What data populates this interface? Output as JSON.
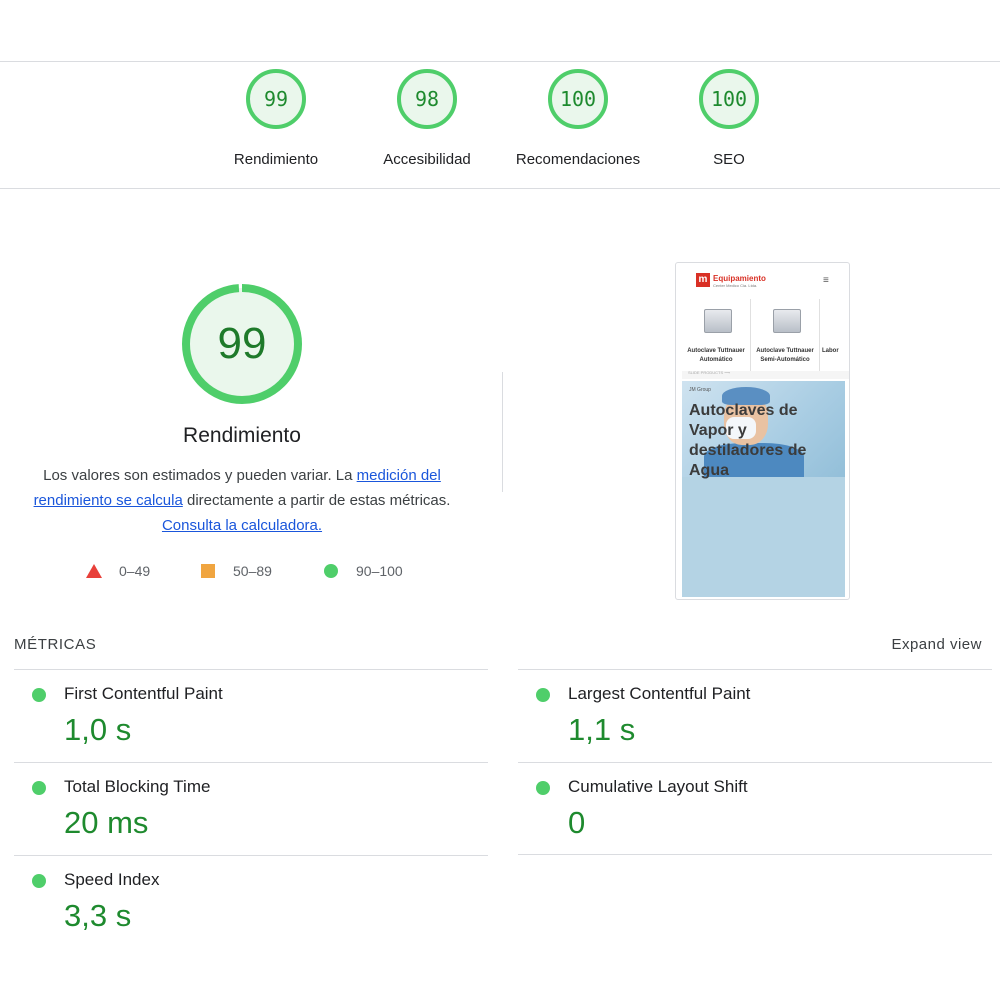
{
  "categories": [
    {
      "score": "99",
      "label": "Rendimiento"
    },
    {
      "score": "98",
      "label": "Accesibilidad"
    },
    {
      "score": "100",
      "label": "Recomendaciones"
    },
    {
      "score": "100",
      "label": "SEO"
    }
  ],
  "performance": {
    "score": "99",
    "score_fraction": 0.99,
    "title": "Rendimiento",
    "desc_part1": "Los valores son estimados y pueden variar. La ",
    "desc_link1": "medición del rendimiento se calcula",
    "desc_part2": " directamente a partir de estas métricas. ",
    "desc_link2": "Consulta la calculadora."
  },
  "legend": [
    {
      "shape": "triangle",
      "color": "#e8403a",
      "label": "0–49"
    },
    {
      "shape": "square",
      "color": "#f0a540",
      "label": "50–89"
    },
    {
      "shape": "circle",
      "color": "#4fce6a",
      "label": "90–100"
    }
  ],
  "thumbnail": {
    "logo_mark": "m",
    "logo_text": "Equipamiento",
    "logo_sub": "Center Medico Cia. Ltda.",
    "menu_icon": "≡",
    "products": [
      {
        "label": "Autoclave Tuttnauer Automático"
      },
      {
        "label": "Autoclave Tuttnauer Semi-Automático"
      },
      {
        "label": "Labor"
      }
    ],
    "sub_label": "SLIDE PRODUCTS ⟶",
    "brand": "JM Group",
    "headline": "Autoclaves de Vapor y destiladores de Agua"
  },
  "metrics": {
    "heading": "MÉTRICAS",
    "expand_label": "Expand view",
    "items": [
      {
        "name": "First Contentful Paint",
        "value": "1,0 s"
      },
      {
        "name": "Largest Contentful Paint",
        "value": "1,1 s"
      },
      {
        "name": "Total Blocking Time",
        "value": "20 ms"
      },
      {
        "name": "Cumulative Layout Shift",
        "value": "0"
      },
      {
        "name": "Speed Index",
        "value": "3,3 s"
      }
    ]
  },
  "colors": {
    "pass": "#4fce6a",
    "pass_text": "#1e8a2e",
    "link": "#1a56db"
  }
}
